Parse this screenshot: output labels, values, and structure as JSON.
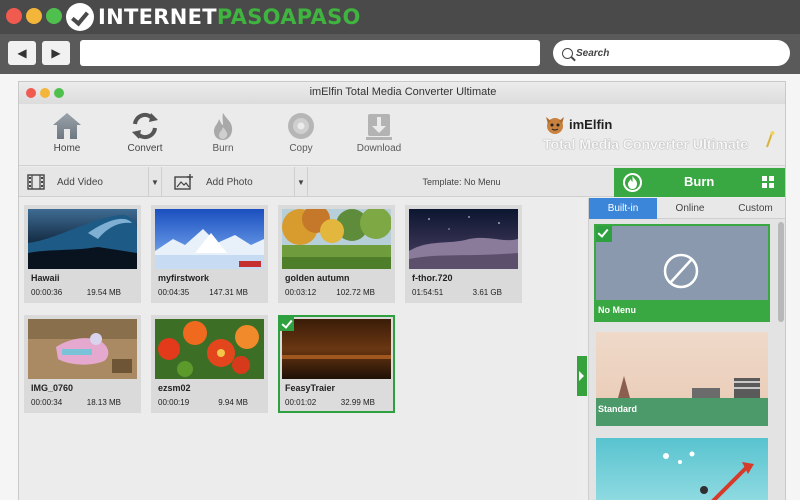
{
  "browser": {
    "brand_part1": "INTERNET",
    "brand_part2": "PASOAPASO",
    "back_icon": "back-arrow-icon",
    "forward_icon": "forward-arrow-icon",
    "search_placeholder": "Search",
    "colors": {
      "titlebar": "#4a4a4a",
      "toolbar": "#5a5a5a",
      "brand_green": "#3fb43f"
    }
  },
  "app": {
    "title": "imElfin Total Media Converter Ultimate",
    "toolbar": [
      {
        "label": "Home",
        "icon": "home-icon"
      },
      {
        "label": "Convert",
        "icon": "convert-icon"
      },
      {
        "label": "Burn",
        "icon": "flame-icon"
      },
      {
        "label": "Copy",
        "icon": "disc-icon"
      },
      {
        "label": "Download",
        "icon": "download-icon"
      }
    ],
    "logo": {
      "name": "imElfin",
      "tagline": "Total Media Converter Ultimate"
    },
    "subbar": {
      "add_video": "Add Video",
      "add_photo": "Add Photo",
      "template": "Template: No Menu"
    },
    "burn_button": {
      "label": "Burn",
      "color": "#3aa842"
    },
    "videos": [
      {
        "name": "Hawaii",
        "duration": "00:00:36",
        "size": "19.54 MB",
        "selected": false
      },
      {
        "name": "myfirstwork",
        "duration": "00:04:35",
        "size": "147.31 MB",
        "selected": false
      },
      {
        "name": "golden autumn",
        "duration": "00:03:12",
        "size": "102.72 MB",
        "selected": false
      },
      {
        "name": "f-thor.720",
        "duration": "01:54:51",
        "size": "3.61 GB",
        "selected": false
      },
      {
        "name": "IMG_0760",
        "duration": "00:00:34",
        "size": "18.13 MB",
        "selected": false
      },
      {
        "name": "ezsm02",
        "duration": "00:00:19",
        "size": "9.94 MB",
        "selected": false
      },
      {
        "name": "FeasyTraier",
        "duration": "00:01:02",
        "size": "32.99 MB",
        "selected": true
      }
    ],
    "panel": {
      "tabs": [
        {
          "label": "Built-in",
          "active": true
        },
        {
          "label": "Online",
          "active": false
        },
        {
          "label": "Custom",
          "active": false
        }
      ],
      "templates": [
        {
          "label": "No Menu",
          "selected": true
        },
        {
          "label": "Standard",
          "selected": false
        },
        {
          "label": "",
          "selected": false
        }
      ],
      "active_tab_color": "#3b86d8"
    }
  }
}
